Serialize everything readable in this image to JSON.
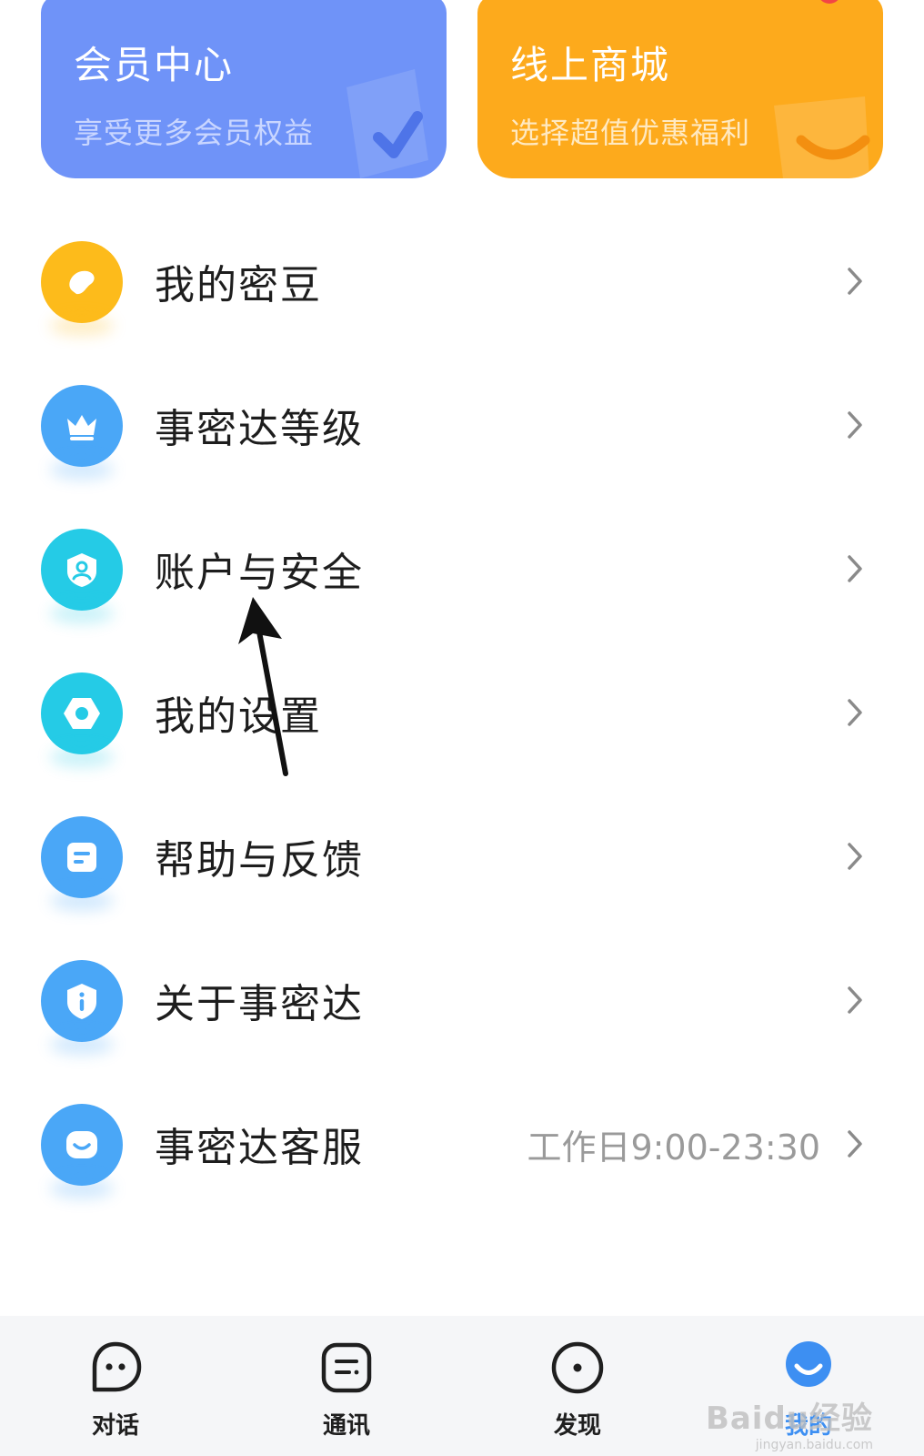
{
  "promo": {
    "member": {
      "title": "会员中心",
      "subtitle": "享受更多会员权益"
    },
    "shop": {
      "title": "线上商城",
      "subtitle": "选择超值优惠福利"
    }
  },
  "menu": {
    "items": [
      {
        "label": "我的密豆",
        "icon": "bean-icon",
        "color": "#fdbb1b"
      },
      {
        "label": "事密达等级",
        "icon": "crown-icon",
        "color": "#4aa7f7"
      },
      {
        "label": "账户与安全",
        "icon": "shield-user-icon",
        "color": "#25cbe6"
      },
      {
        "label": "我的设置",
        "icon": "hexagon-gear-icon",
        "color": "#25cbe6"
      },
      {
        "label": "帮助与反馈",
        "icon": "document-icon",
        "color": "#4aa7f7"
      },
      {
        "label": "关于事密达",
        "icon": "info-shield-icon",
        "color": "#4aa7f7"
      },
      {
        "label": "事密达客服",
        "icon": "smile-chat-icon",
        "color": "#4aa7f7",
        "extra": "工作日9:00-23:30"
      }
    ]
  },
  "bottom_nav": {
    "items": [
      {
        "label": "对话",
        "icon": "chat-bubble-icon"
      },
      {
        "label": "通讯",
        "icon": "contacts-icon"
      },
      {
        "label": "发现",
        "icon": "compass-icon"
      },
      {
        "label": "我的",
        "icon": "profile-icon",
        "active": true
      }
    ]
  },
  "watermark": {
    "text": "Baidu经验",
    "sub": "jingyan.baidu.com"
  },
  "colors": {
    "accent": "#3d8ff2",
    "member_card": "#6f93f8",
    "shop_card": "#fdaa1c"
  }
}
